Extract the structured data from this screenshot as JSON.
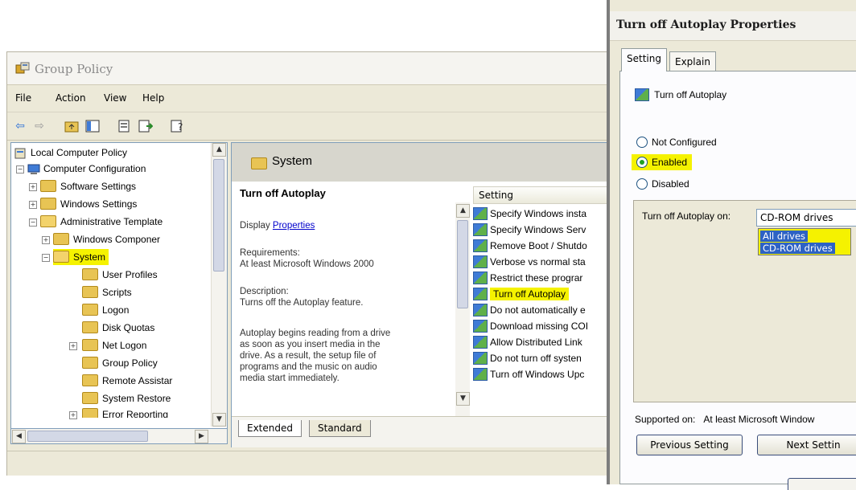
{
  "window": {
    "title": "Group Policy"
  },
  "menu": [
    {
      "label": "File"
    },
    {
      "label": "Action"
    },
    {
      "label": "View"
    },
    {
      "label": "Help"
    }
  ],
  "toolbar": {
    "icons": [
      "back-arrow-icon",
      "forward-arrow-icon",
      "up-folder-icon",
      "show-hide-tree-icon",
      "properties-icon",
      "export-list-icon",
      "help-icon"
    ]
  },
  "tree": {
    "items": [
      {
        "label": "Local Computer Policy"
      },
      {
        "label": "Computer Configuration"
      },
      {
        "label": "Software Settings"
      },
      {
        "label": "Windows Settings"
      },
      {
        "label": "Administrative Template"
      },
      {
        "label": "Windows Componer"
      },
      {
        "label": "System"
      },
      {
        "label": "User Profiles"
      },
      {
        "label": "Scripts"
      },
      {
        "label": "Logon"
      },
      {
        "label": "Disk Quotas"
      },
      {
        "label": "Net Logon"
      },
      {
        "label": "Group Policy"
      },
      {
        "label": "Remote Assistar"
      },
      {
        "label": "System Restore"
      },
      {
        "label": "Error Reporting"
      }
    ]
  },
  "content": {
    "header": "System",
    "policy_title": "Turn off Autoplay",
    "display_prefix": "Display",
    "display_link": "Properties",
    "requirements_label": "Requirements:",
    "requirements_value": "At least Microsoft Windows 2000",
    "description_label": "Description:",
    "description_line": "Turns off the Autoplay feature.",
    "autoplay_text": [
      "Autoplay begins reading from a drive",
      "as soon as you insert media in the",
      "drive. As a result, the setup file of",
      "programs and the music on audio",
      "media start immediately."
    ],
    "list_header": "Setting",
    "settings": [
      {
        "label": "Specify Windows insta"
      },
      {
        "label": "Specify Windows Serv"
      },
      {
        "label": "Remove Boot / Shutdo"
      },
      {
        "label": "Verbose vs normal sta"
      },
      {
        "label": "Restrict these prograr"
      },
      {
        "label": "Turn off Autoplay"
      },
      {
        "label": "Do not automatically e"
      },
      {
        "label": "Download missing COI"
      },
      {
        "label": "Allow Distributed Link"
      },
      {
        "label": "Do not turn off systen"
      },
      {
        "label": "Turn off Windows Upc"
      }
    ],
    "tabs": [
      {
        "label": "Extended"
      },
      {
        "label": "Standard"
      }
    ]
  },
  "dialog": {
    "title": "Turn off Autoplay Properties",
    "tabs": [
      {
        "label": "Setting"
      },
      {
        "label": "Explain"
      }
    ],
    "policy_name": "Turn off Autoplay",
    "radios": [
      {
        "label": "Not Configured",
        "selected": false
      },
      {
        "label": "Enabled",
        "selected": true
      },
      {
        "label": "Disabled",
        "selected": false
      }
    ],
    "option_label": "Turn off Autoplay on:",
    "option_value": "CD-ROM drives",
    "dropdown_options": [
      "All drives",
      "CD-ROM drives"
    ],
    "supported_label": "Supported on:",
    "supported_value": "At least Microsoft Window",
    "prev_button": "Previous Setting",
    "next_button": "Next Settin"
  },
  "colors": {
    "highlight": "#f5f200",
    "selection": "#2d62c4",
    "link": "#0000cc"
  }
}
